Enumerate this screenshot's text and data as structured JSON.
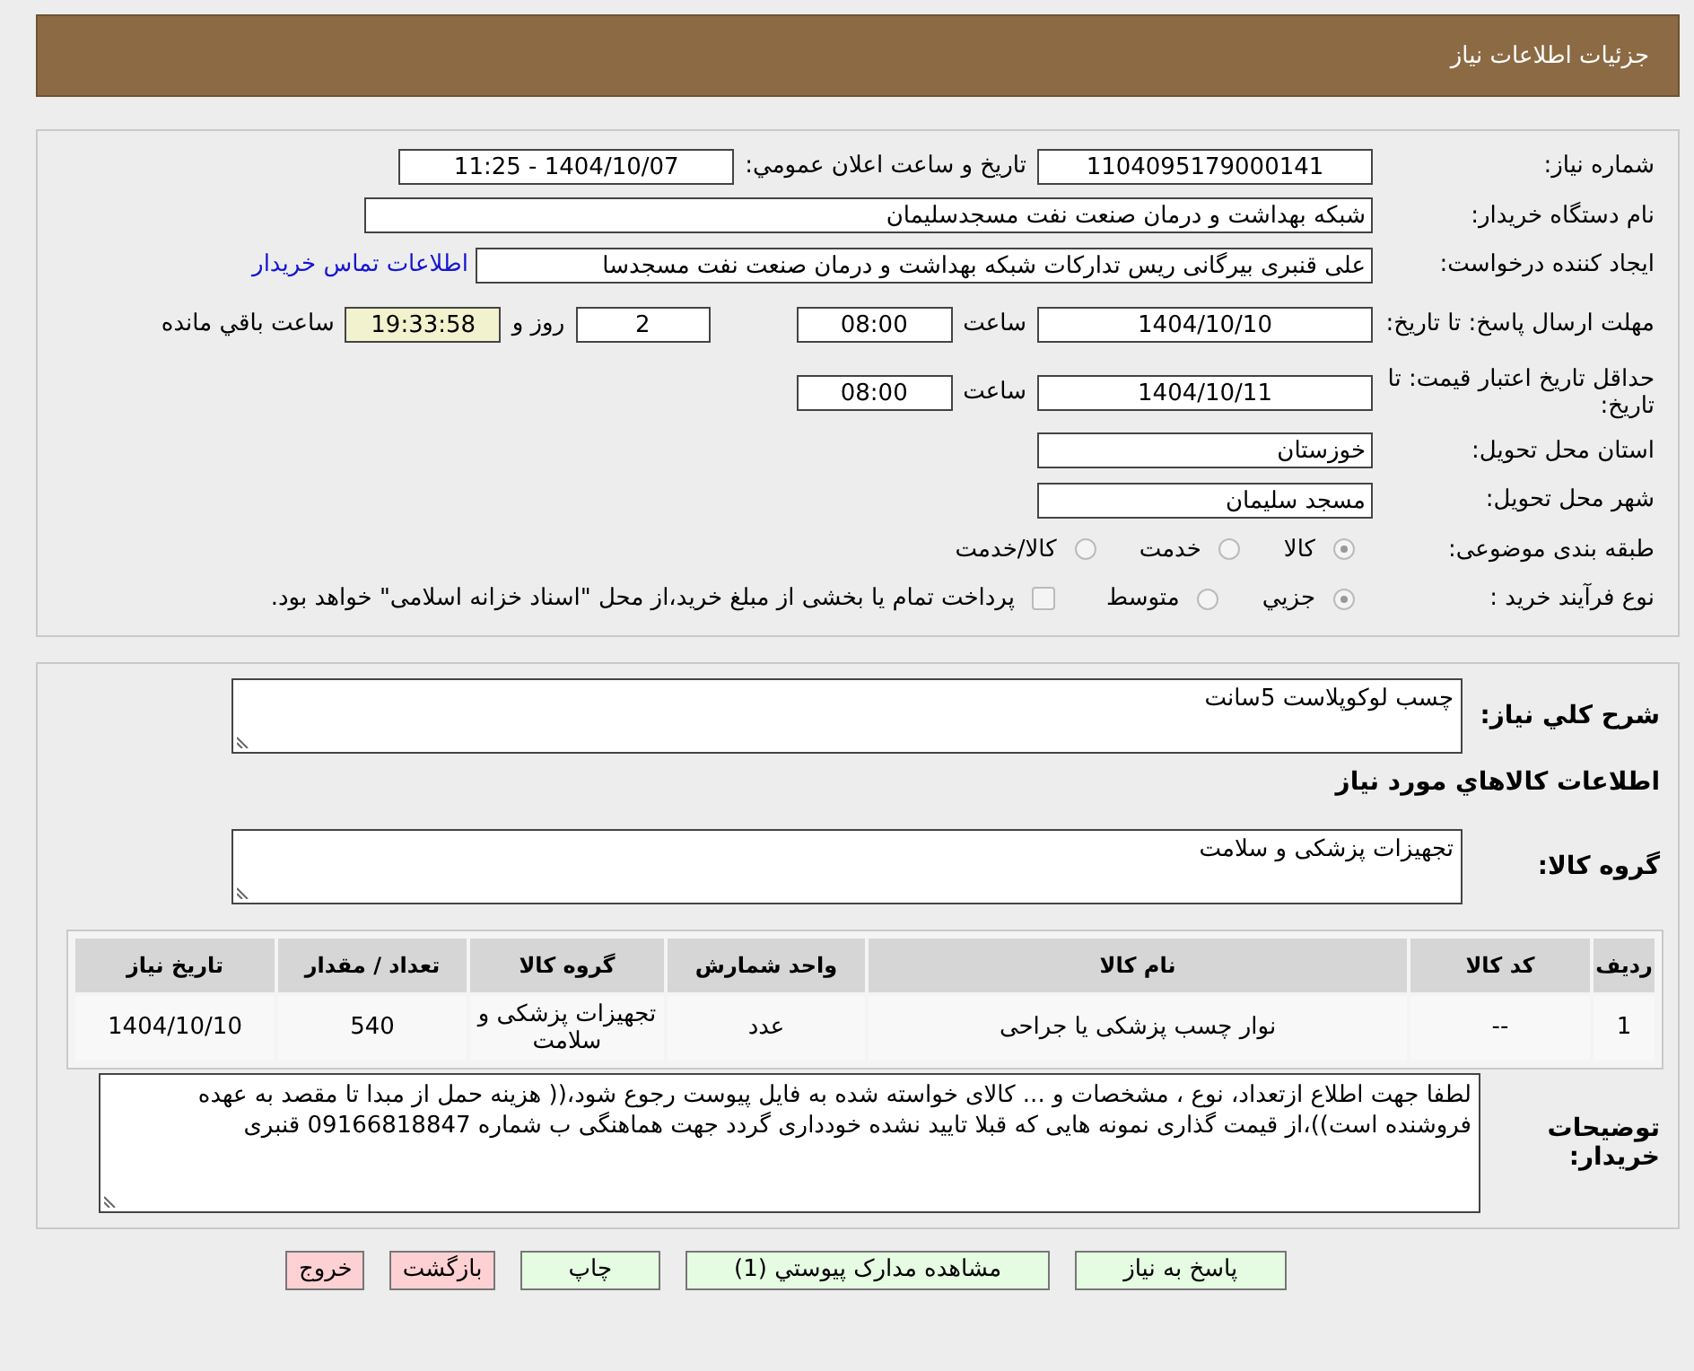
{
  "header": {
    "title": "جزئیات اطلاعات نیاز"
  },
  "details": {
    "need_number": {
      "label": "شماره نیاز:",
      "value": "1104095179000141"
    },
    "announce": {
      "label": "تاریخ و ساعت اعلان عمومي:",
      "value": "1404/10/07 - 11:25"
    },
    "buyer": {
      "label": "نام دستگاه خریدار:",
      "value": "شبکه بهداشت و درمان صنعت نفت مسجدسلیمان"
    },
    "creator": {
      "label": "ایجاد کننده درخواست:",
      "value": "علی قنبری بیرگانی ریس تدارکات شبکه بهداشت و درمان صنعت نفت مسجدسا",
      "link": "اطلاعات تماس خریدار"
    },
    "deadline": {
      "label": "مهلت ارسال پاسخ: تا تاریخ:",
      "date": "1404/10/10",
      "time_label": "ساعت",
      "time": "08:00",
      "days": "2",
      "days_label": "روز و",
      "remaining": "19:33:58",
      "remaining_label": "ساعت باقي مانده"
    },
    "validity": {
      "label": "حداقل تاریخ اعتبار قیمت: تا تاریخ:",
      "date": "1404/10/11",
      "time_label": "ساعت",
      "time": "08:00"
    },
    "province": {
      "label": "استان محل تحویل:",
      "value": "خوزستان"
    },
    "city": {
      "label": "شهر محل تحویل:",
      "value": "مسجد سلیمان"
    },
    "category": {
      "label": "طبقه بندی موضوعی:",
      "options": [
        {
          "label": "کالا",
          "selected": true
        },
        {
          "label": "خدمت",
          "selected": false
        },
        {
          "label": "کالا/خدمت",
          "selected": false
        }
      ]
    },
    "process": {
      "label": "نوع فرآیند خرید :",
      "options": [
        {
          "label": "جزيي",
          "selected": true
        },
        {
          "label": "متوسط",
          "selected": false
        }
      ],
      "treasury": {
        "checked": false,
        "text": "پرداخت تمام یا بخشی از مبلغ خرید،از محل \"اسناد خزانه اسلامی\" خواهد بود."
      }
    }
  },
  "goods": {
    "description": {
      "label": "شرح کلي نیاز:",
      "value": "چسب لوکوپلاست 5سانت"
    },
    "heading": "اطلاعات کالاهاي مورد نياز",
    "group": {
      "label": "گروه کالا:",
      "value": "تجهیزات پزشکی و سلامت"
    },
    "table": {
      "columns": [
        "ردیف",
        "کد کالا",
        "نام کالا",
        "واحد شمارش",
        "گروه کالا",
        "تعداد / مقدار",
        "تاریخ نیاز"
      ],
      "rows": [
        [
          "1",
          "--",
          "نوار چسب پزشکی یا جراحی",
          "عدد",
          "تجهیزات پزشکی و سلامت",
          "540",
          "1404/10/10"
        ]
      ]
    },
    "notes": {
      "label": "توضیحات خریدار:",
      "value": "لطفا جهت اطلاع ازتعداد، نوع ، مشخصات و ... کالای خواسته شده به فایل پیوست رجوع شود،(( هزینه حمل از مبدا تا مقصد به عهده فروشنده است))،از قیمت گذاری نمونه هایی که قبلا تایید نشده خودداری گردد جهت هماهنگی ب شماره 09166818847 قنبری"
    }
  },
  "buttons": [
    {
      "label": "پاسخ به نیاز",
      "kind": "normal"
    },
    {
      "label": "مشاهده مدارک پیوستي (1)",
      "kind": "normal"
    },
    {
      "label": "چاپ",
      "kind": "normal"
    },
    {
      "label": "بازگشت",
      "kind": "exit"
    },
    {
      "label": "خروج",
      "kind": "exit"
    }
  ]
}
